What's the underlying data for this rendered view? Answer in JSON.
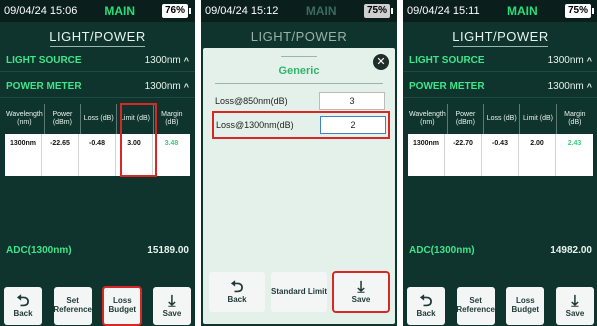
{
  "panels": [
    {
      "status": {
        "time": "09/04/24 15:06",
        "mode": "MAIN",
        "battery": "76%"
      },
      "title": "LIGHT/POWER",
      "light_source": {
        "label": "LIGHT SOURCE",
        "value": "1300nm"
      },
      "power_meter": {
        "label": "POWER METER",
        "value": "1300nm"
      },
      "table": {
        "headers": [
          "Wavelength (nm)",
          "Power (dBm)",
          "Loss (dB)",
          "Limit (dB)",
          "Margin (dB)"
        ],
        "row": [
          "1300nm",
          "-22.65",
          "-0.48",
          "3.00",
          "3.48"
        ]
      },
      "adc": {
        "label": "ADC(1300nm)",
        "value": "15189.00"
      },
      "buttons": [
        "Back",
        "Set Reference",
        "Loss Budget",
        "Save"
      ]
    },
    {
      "status": {
        "time": "09/04/24 15:12",
        "mode": "MAIN",
        "battery": "75%"
      },
      "title": "LIGHT/POWER",
      "modal": {
        "title": "Generic",
        "fields": [
          {
            "label": "Loss@850nm(dB)",
            "value": "3"
          },
          {
            "label": "Loss@1300nm(dB)",
            "value": "2"
          }
        ],
        "buttons": [
          "Back",
          "Standard Limit",
          "Save"
        ]
      }
    },
    {
      "status": {
        "time": "09/04/24 15:11",
        "mode": "MAIN",
        "battery": "75%"
      },
      "title": "LIGHT/POWER",
      "light_source": {
        "label": "LIGHT SOURCE",
        "value": "1300nm"
      },
      "power_meter": {
        "label": "POWER METER",
        "value": "1300nm"
      },
      "table": {
        "headers": [
          "Wavelength (nm)",
          "Power (dBm)",
          "Loss (dB)",
          "Limit (dB)",
          "Margin (dB)"
        ],
        "row": [
          "1300nm",
          "-22.70",
          "-0.43",
          "2.00",
          "2.43"
        ]
      },
      "adc": {
        "label": "ADC(1300nm)",
        "value": "14982.00"
      },
      "buttons": [
        "Back",
        "Set Reference",
        "Loss Budget",
        "Save"
      ]
    }
  ],
  "icons": {
    "back": "back-arrow-icon",
    "save": "download-icon",
    "close": "close-icon",
    "chevron": "chevron-up-icon"
  },
  "colors": {
    "accent": "#3ee58a",
    "background": "#0f332d",
    "highlight": "#d72727",
    "modal": "#e4f1ea"
  }
}
